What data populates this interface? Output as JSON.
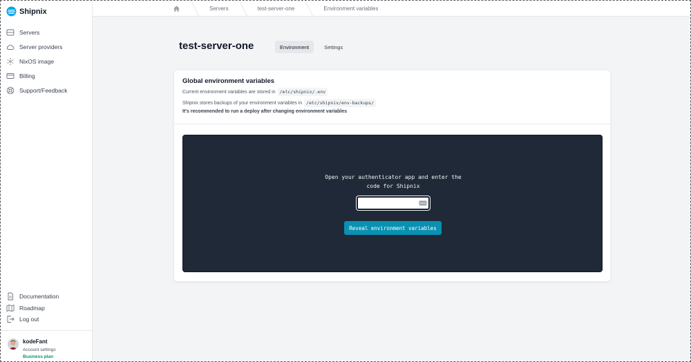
{
  "app": {
    "name": "Shipnix"
  },
  "sidebar": {
    "items": [
      {
        "label": "Servers",
        "icon": "server-icon"
      },
      {
        "label": "Server providers",
        "icon": "cloud-icon"
      },
      {
        "label": "NixOS image",
        "icon": "nixos-icon"
      },
      {
        "label": "Billing",
        "icon": "credit-card-icon"
      },
      {
        "label": "Support/Feedback",
        "icon": "lifebuoy-icon"
      }
    ],
    "bottom_items": [
      {
        "label": "Documentation",
        "icon": "document-icon"
      },
      {
        "label": "Roadmap",
        "icon": "map-icon"
      },
      {
        "label": "Log out",
        "icon": "logout-icon"
      }
    ],
    "user": {
      "name": "kodeFant",
      "settings_label": "Account settings",
      "plan": "Business plan"
    }
  },
  "breadcrumb": {
    "items": [
      "Servers",
      "test-server-one",
      "Environment variables"
    ]
  },
  "page": {
    "title": "test-server-one",
    "tabs": [
      {
        "label": "Environment",
        "active": true
      },
      {
        "label": "Settings",
        "active": false
      }
    ]
  },
  "env_card": {
    "title": "Global environment variables",
    "line1_text": "Current environment variables are stored in",
    "line1_code": "/etc/shipnix/.env",
    "line2_text": "Shipnix stores backups of your environment variables in",
    "line2_code": "/etc/shipnix/env-backups/",
    "line3_text": "It's recommended to run a deploy after changing environment variables"
  },
  "auth_panel": {
    "prompt_line1": "Open your authenticator app and enter the",
    "prompt_line2": "code for Shipnix",
    "code_value": "",
    "code_placeholder": "",
    "reveal_button": "Reveal environment variables"
  },
  "colors": {
    "accent": "#0891b2",
    "terminal_bg": "#1f2937",
    "page_bg": "#f3f4f6",
    "plan": "#059669",
    "logo": "#0ea5e9"
  }
}
